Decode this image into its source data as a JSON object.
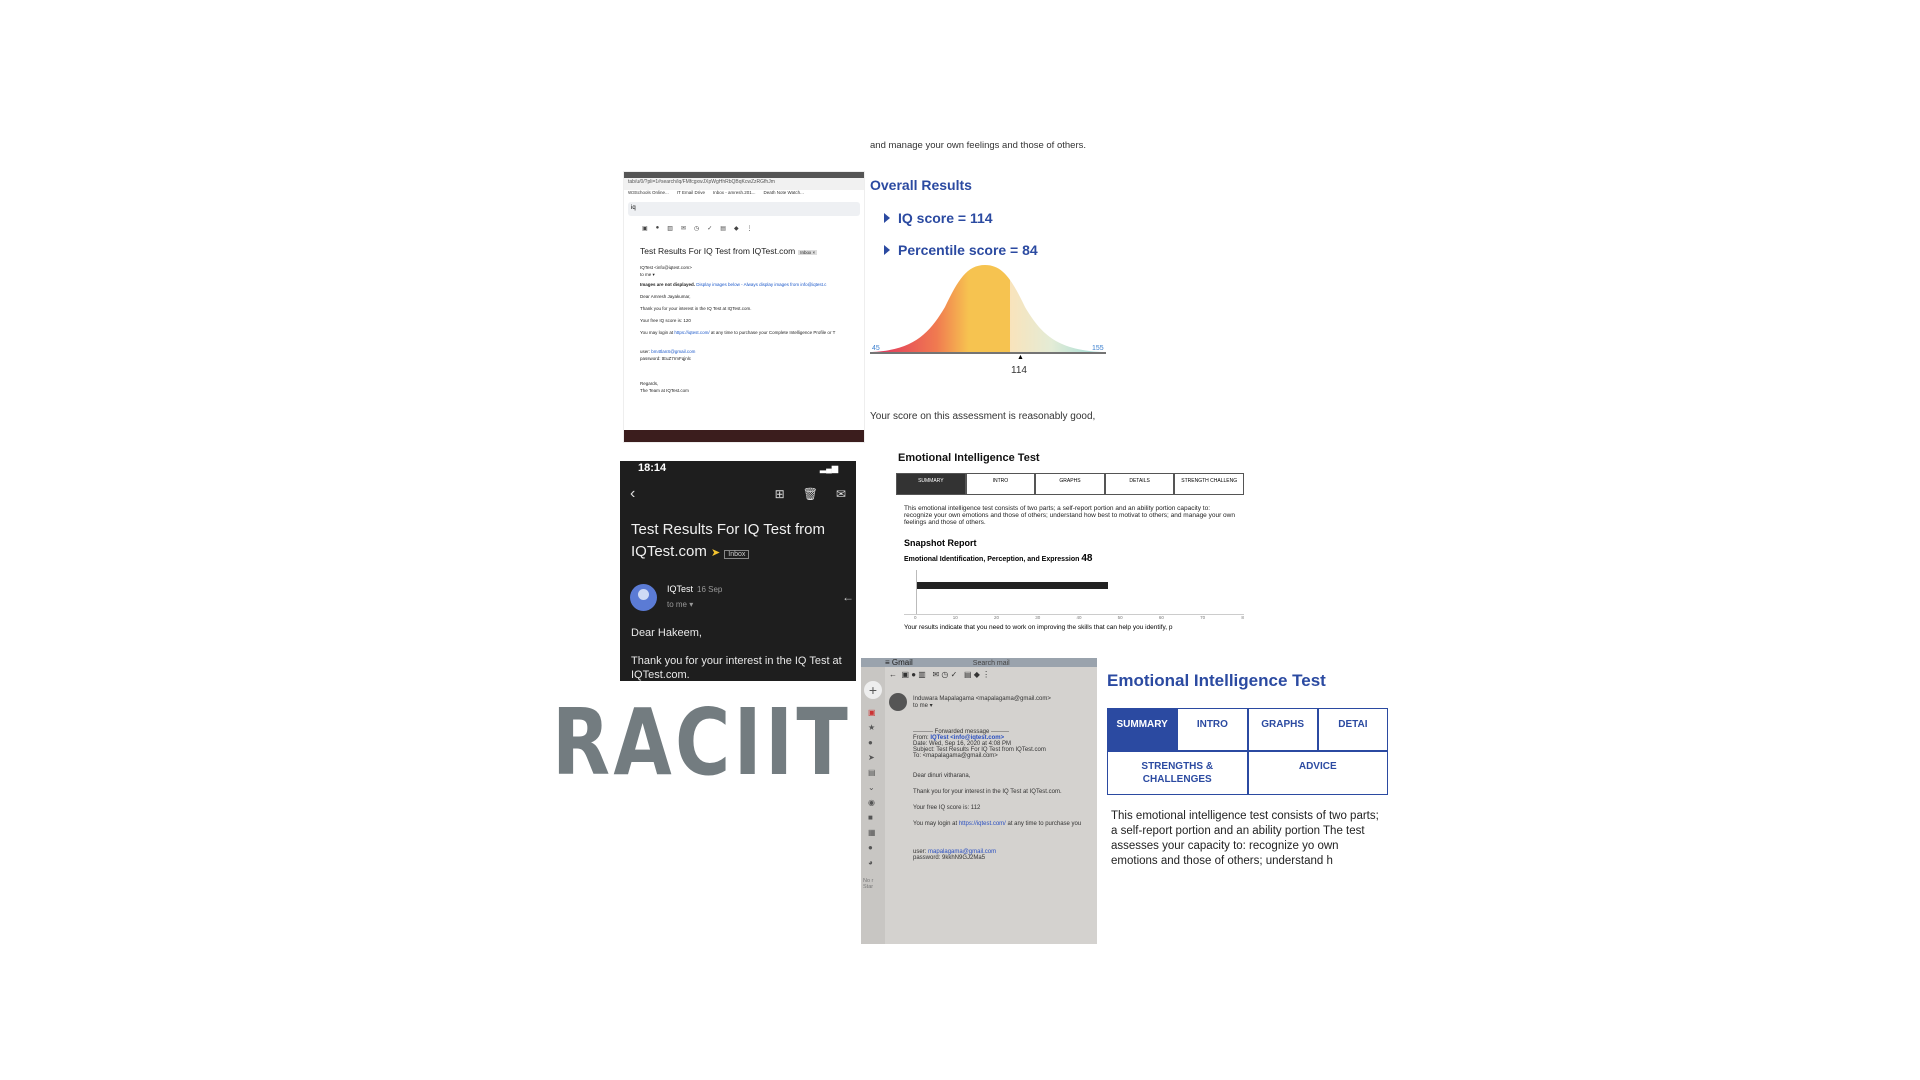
{
  "logo": {
    "text": "RACIIT"
  },
  "desktop_email": {
    "url": "tab/u/0/?pli=1#search/iq/FMfcgxwJXpWgHhRbQBqKcwZzRGfhJm",
    "bookmarks": [
      "W3Schools Online...",
      "IT Email Drive",
      "Inbox - amresh.201...",
      "Death Note Watch..."
    ],
    "search": "iq",
    "subject": "Test Results For IQ Test from IQTest.com",
    "inbox_tag": "Inbox ×",
    "sender": "IQTest <info@iqtest.com>",
    "to": "to me ▾",
    "images_notice": "Images are not displayed.",
    "images_link": "Display images below - Always display images from info@iqtest.c",
    "greeting": "Dear Amresh Jayakumar,",
    "line1": "Thank you for your interest in the IQ Test at IQTest.com.",
    "line2": "Your free IQ score is: 120",
    "line3_pre": "You may login at ",
    "line3_link": "https://iqtest.com/",
    "line3_post": " at any time to purchase your Complete Intelligence Profile or T",
    "user_label": "user: ",
    "user_value": "bm4tlanS@gmail.com",
    "password": "password: tEuZ7rmFqjnlc",
    "regards": "Regards,",
    "team": "The Team at IQTest.com"
  },
  "overall": {
    "intro": "and manage your own feelings and those of others.",
    "heading": "Overall Results",
    "iq": "IQ score = 114",
    "percentile": "Percentile score = 84",
    "axis_min": "45",
    "axis_max": "155",
    "marker": "114",
    "footer": "Your score on this assessment is reasonably good,"
  },
  "phone": {
    "time": "18:14",
    "subject": "Test Results For IQ Test from IQTest.com",
    "inbox": "Inbox",
    "sender": "IQTest",
    "date": "16 Sep",
    "to": "to me ▾",
    "greeting": "Dear Hakeem,",
    "body": "Thank you for your interest in the IQ Test at IQTest.com."
  },
  "ei_small": {
    "title": "Emotional Intelligence Test",
    "tabs": [
      "SUMMARY",
      "INTRO",
      "GRAPHS",
      "DETAILS",
      "STRENGTH CHALLENG"
    ],
    "desc": "This emotional intelligence test consists of two parts; a self-report portion and an ability portion capacity to: recognize your own emotions and those of others; understand how best to motivat to others; and manage your own feelings and those of others.",
    "snapshot": "Snapshot Report",
    "category": "Emotional Identification, Perception, and Expression",
    "score": "48",
    "ticks": [
      "0",
      "10",
      "20",
      "30",
      "40",
      "50",
      "60",
      "70",
      "8"
    ],
    "footer": "Your results indicate that you need to work on improving the skills that can help you identify, p"
  },
  "gmail_photo": {
    "app": "Gmail",
    "search": "Search mail",
    "sender": "Induwara Mapalagama <mapalagama@gmail.com>",
    "to": "to me ▾",
    "fwd": "---------- Forwarded message ---------",
    "from_label": "From: ",
    "from_value": "IQTest <info@iqtest.com>",
    "date": "Date: Wed, Sep 16, 2020 at 4:08 PM",
    "subject": "Subject: Test Results For IQ Test from IQTest.com",
    "to_line": "To: <mapalagama@gmail.com>",
    "greeting": "Dear dinuri vitharana,",
    "line1": "Thank you for your interest in the IQ Test at IQTest.com.",
    "line2": "Your free IQ score is: 112",
    "line3_pre": "You may login at ",
    "line3_link": "https://iqtest.com/",
    "line3_post": " at any time to purchase you",
    "user_label": "user: ",
    "user_value": "mapalagama@gmail.com",
    "password": "password: 9kkhN9GJ2Ma5",
    "side_text1": "No r",
    "side_text2": "Star"
  },
  "ei_large": {
    "title": "Emotional Intelligence Test",
    "tabs": [
      "SUMMARY",
      "INTRO",
      "GRAPHS",
      "DETAI"
    ],
    "tab_strengths": "STRENGTHS & CHALLENGES",
    "tab_advice": "ADVICE",
    "desc": "This emotional intelligence test consists of two parts; a self-report portion and an ability portion The test assesses your capacity to: recognize yo own emotions and those of others; understand h"
  },
  "colors": {
    "accent_blue": "#2b4aa1",
    "logo_gray": "#737c80",
    "dark_bg": "#1e1e1e"
  }
}
